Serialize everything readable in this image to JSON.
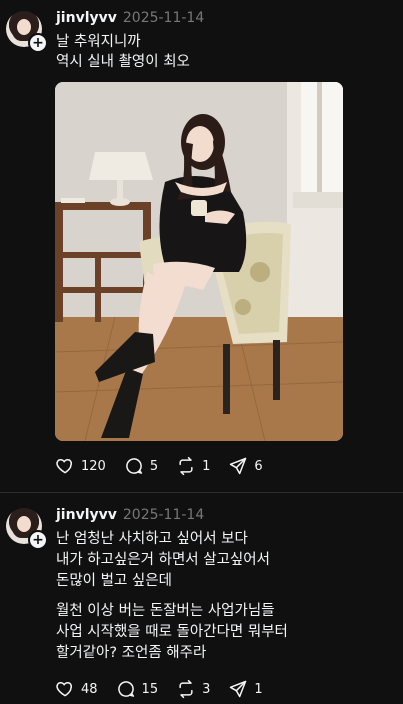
{
  "posts": [
    {
      "username": "jinvlyvv",
      "timestamp": "2025-11-14",
      "text": "날 추워지니까\n역시 실내 촬영이 최오",
      "stats": {
        "likes": "120",
        "comments": "5",
        "reposts": "1",
        "shares": "6"
      }
    },
    {
      "username": "jinvlyvv",
      "timestamp": "2025-11-14",
      "text": "난 엄청난 사치하고 싶어서 보다\n내가 하고싶은거 하면서 살고싶어서\n돈많이 벌고 싶은데",
      "text2": "월천 이상 버는 돈잘버는 사업가님들\n사업 시작했을 때로 돌아간다면 뭐부터\n할거같아? 조언좀 해주라",
      "stats": {
        "likes": "48",
        "comments": "15",
        "reposts": "3",
        "shares": "1"
      }
    }
  ],
  "icons": {
    "like": "heart-icon",
    "comment": "comment-bubble-icon",
    "repost": "repost-icon",
    "share": "send-icon",
    "follow": "plus-icon"
  },
  "colors": {
    "background": "#101010",
    "text": "#f3f5f7",
    "muted": "#777777",
    "divider": "#2d2d2d"
  }
}
